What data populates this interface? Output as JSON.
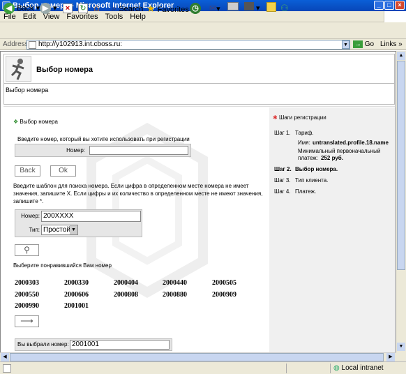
{
  "window": {
    "title": "Выбор номера - Microsoft Internet Explorer"
  },
  "menu": [
    "File",
    "Edit",
    "View",
    "Favorites",
    "Tools",
    "Help"
  ],
  "toolbar": {
    "back": "Back",
    "search": "Search",
    "favorites": "Favorites"
  },
  "address": {
    "label": "Address",
    "url": "http://y102913.int.cboss.ru:",
    "go": "Go",
    "links": "Links"
  },
  "header": {
    "title": "Выбор номера",
    "breadcrumb": "Выбор номера"
  },
  "main": {
    "section_title": "Выбор номера",
    "instruction": "Введите номер, который вы хотите использовать при регистрации",
    "number_label": "Номер:",
    "number_value": "",
    "back_button": "Back",
    "ok_button": "Ok",
    "pattern_help": "Введите шаблон для поиска номера. Если цифра в определенном месте номера не имеет значения, запишите X. Если цифры и их количество в определенном месте не имеют значения, запишите *.",
    "pattern_label": "Номер:",
    "pattern_value": "200XXXX",
    "type_label": "Тип:",
    "type_value": "Простой",
    "choose_text": "Выберите понравившийся Вам номер",
    "numbers": [
      "2000303",
      "2000330",
      "2000404",
      "2000440",
      "2000505",
      "2000550",
      "2000606",
      "2000808",
      "2000880",
      "2000909",
      "2000990",
      "2001001"
    ],
    "selected_label": "Вы выбрали номер:",
    "selected_value": "2001001"
  },
  "sidebar": {
    "title": "Шаги регистрации",
    "step1_label": "Шаг 1.",
    "step1_name": "Тариф.",
    "name_label": "Имя:",
    "name_value": "untranslated.profile.18.name",
    "payment_label": "Минимальный первоначальный платеж:",
    "payment_value": "252 руб.",
    "step2_label": "Шаг 2.",
    "step2_name": "Выбор номера.",
    "step3_label": "Шаг 3.",
    "step3_name": "Тип клиента.",
    "step4_label": "Шаг 4.",
    "step4_name": "Платеж."
  },
  "status": {
    "zone": "Local intranet"
  }
}
